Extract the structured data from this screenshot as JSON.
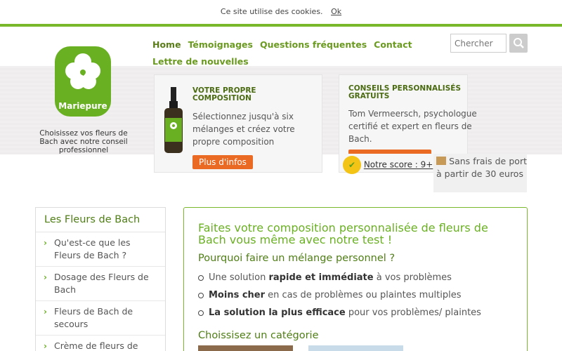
{
  "cookie": {
    "text": "Ce site utilise des cookies.",
    "ok": "Ok"
  },
  "logo": {
    "text": "Mariepure"
  },
  "tagline": "Choisissez vos fleurs de Bach avec notre conseil professionnel",
  "nav": {
    "items": [
      {
        "label": "Home"
      },
      {
        "label": "Témoignages"
      },
      {
        "label": "Questions fréquentes"
      },
      {
        "label": "Contact"
      },
      {
        "label": "Lettre de nouvelles"
      }
    ]
  },
  "search": {
    "placeholder": "Chercher"
  },
  "cards": [
    {
      "title": "VOTRE PROPRE COMPOSITION",
      "text": "Sélectionnez jusqu'à six mélanges et créez votre propre composition",
      "button": "Plus d'infos"
    },
    {
      "title": "CONSEILS PERSONNALISÉS GRATUITS",
      "text": "Tom Vermeersch, psychologue certifié et expert en fleurs de Bach."
    }
  ],
  "score": {
    "label": "Notre score : 9+"
  },
  "shipping": {
    "text": "Sans frais de port à partir de 30 euros"
  },
  "sidebar": {
    "title": "Les Fleurs de Bach",
    "items": [
      {
        "label": "Qu'est-ce que les Fleurs de Bach ?"
      },
      {
        "label": "Dosage des Fleurs de Bach"
      },
      {
        "label": "Fleurs de Bach de secours"
      },
      {
        "label": "Crème de fleurs de"
      }
    ]
  },
  "main": {
    "title": "Faites votre composition personnalisée de fleurs de Bach vous même avec notre test !",
    "subtitle": "Pourquoi faire un mélange personnel ?",
    "bullets": [
      {
        "before": "Une solution ",
        "bold": "rapide et immédiate",
        "after": " à vos problèmes"
      },
      {
        "before": "",
        "bold": "Moins cher",
        "after": " en cas de problèmes ou plaintes multiples"
      },
      {
        "before": "",
        "bold": "La solution la plus efficace",
        "after": " pour vos problèmes/ plaintes"
      }
    ],
    "category_title": "Choissisez un catégorie"
  }
}
